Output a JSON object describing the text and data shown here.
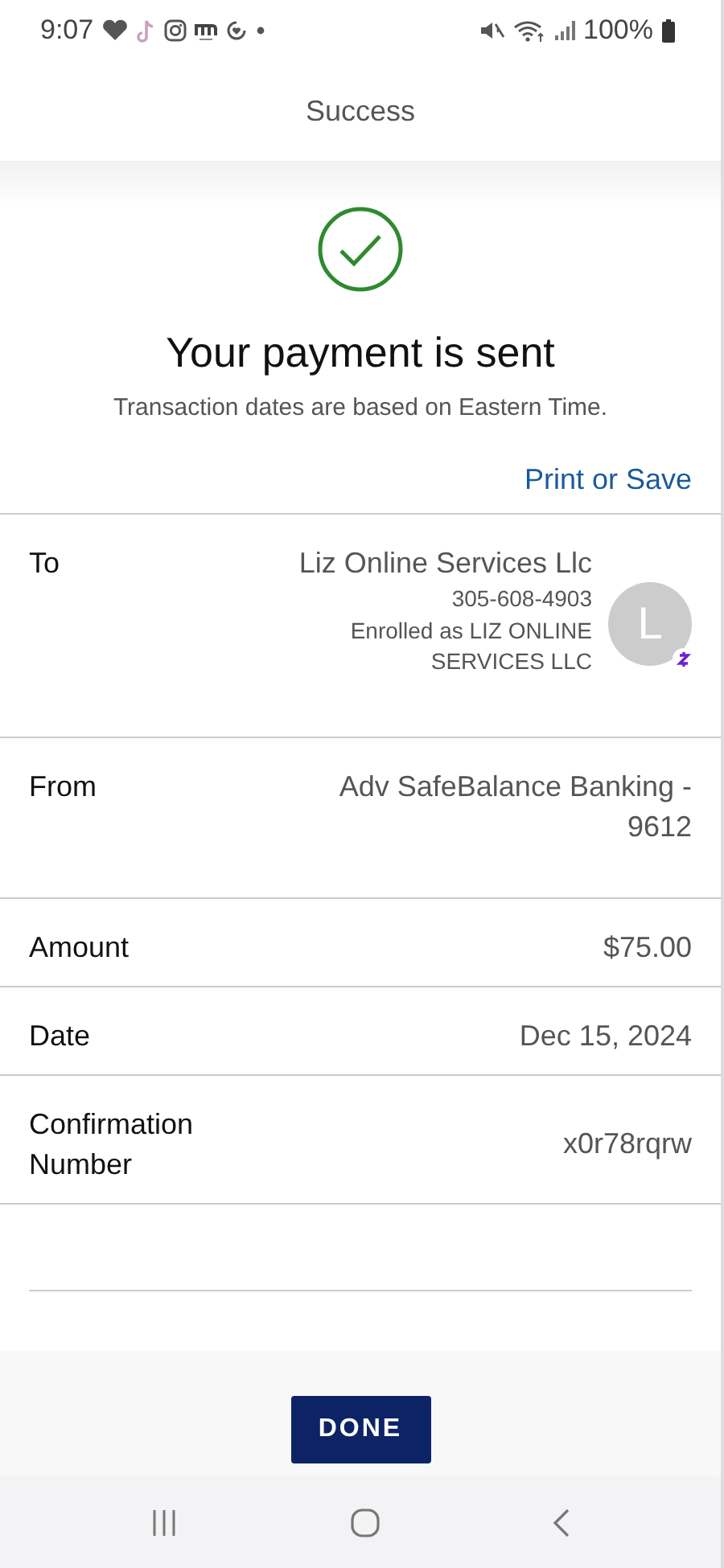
{
  "status_bar": {
    "time": "9:07",
    "battery": "100%"
  },
  "header": {
    "title": "Success"
  },
  "result": {
    "title": "Your payment is sent",
    "note": "Transaction dates are based on Eastern Time.",
    "link": "Print or Save"
  },
  "details": [
    {
      "kind": "recipient",
      "label": "To",
      "value": "Liz Online Services Llc",
      "phone": "305-608-4903",
      "enrolled": "Enrolled as LIZ ONLINE SERVICES LLC",
      "initial": "L"
    },
    {
      "kind": "plain",
      "label": "From",
      "value": "Adv SafeBalance Banking - 9612"
    },
    {
      "kind": "plain",
      "label": "Amount",
      "value": "$75.00"
    },
    {
      "kind": "plain",
      "label": "Date",
      "value": "Dec 15, 2024"
    },
    {
      "kind": "plain",
      "label": "Confirmation Number",
      "value": "x0r78rqrw"
    }
  ],
  "button": "DONE"
}
